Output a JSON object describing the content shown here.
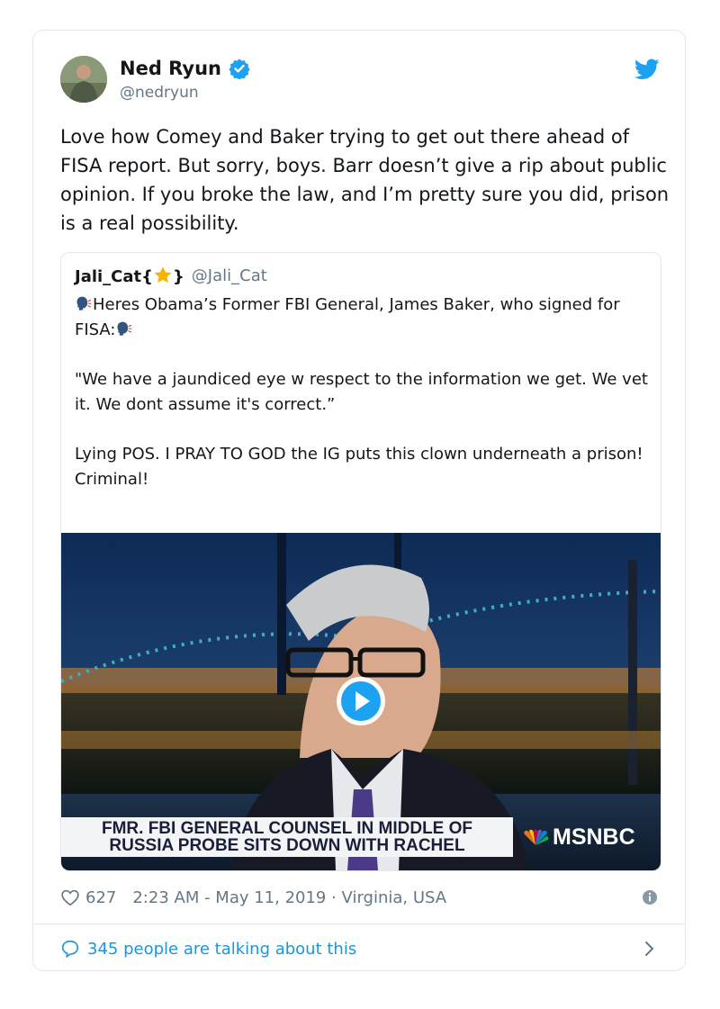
{
  "tweet": {
    "author_name": "Ned Ryun",
    "author_handle": "@nedryun",
    "text": "Love how Comey and Baker trying to get out there ahead of FISA report. But sorry, boys. Barr doesn’t give a rip about public opinion. If you broke the law, and I’m pretty sure you did, prison is a real possibility."
  },
  "quote": {
    "name_prefix": "Jali_Cat{",
    "name_suffix": "}",
    "handle": "@Jali_Cat",
    "line1": "Heres Obama’s Former FBI General, James Baker, who signed for FISA:",
    "line2": "\"We have a jaundiced eye w respect to the information we get. We vet it. We dont assume it's correct.”",
    "line3": "Lying POS. I PRAY TO GOD the IG puts this clown underneath a prison! Criminal!"
  },
  "video": {
    "chyron_line1": "FMR. FBI GENERAL COUNSEL IN MIDDLE OF",
    "chyron_line2": "RUSSIA PROBE SITS DOWN WITH RACHEL",
    "network": "MSNBC"
  },
  "meta": {
    "likes": "627",
    "timestamp": "2:23 AM - May 11, 2019 · Virginia, USA"
  },
  "footer": {
    "talking": "345 people are talking about this"
  },
  "colors": {
    "link_blue": "#1b95e0",
    "verified_blue": "#1da1f2",
    "muted_gray": "#657786"
  },
  "icons": [
    "verified-badge-icon",
    "twitter-bird-icon",
    "star-icon",
    "speaking-head-icon",
    "play-icon",
    "heart-icon",
    "info-icon",
    "speech-bubble-icon",
    "chevron-right-icon"
  ]
}
